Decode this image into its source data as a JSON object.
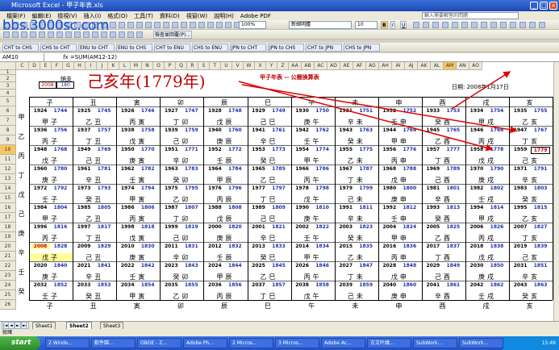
{
  "window": {
    "title": "Microsoft Excel - 甲子年表.xls",
    "help_placeholder": "輸入需要解答的問題"
  },
  "watermark": "bbs.3000sc.com",
  "menu": [
    "檔案(F)",
    "編輯(E)",
    "檢視(V)",
    "插入(I)",
    "格式(O)",
    "工具(T)",
    "資料(D)",
    "視窗(W)",
    "說明(H)",
    "Adobe PDF"
  ],
  "toolbar": {
    "zoom": "100%",
    "font": "新細明體",
    "size": "10",
    "review_label": "檢查並回覆(P)...",
    "bold": "B",
    "italic": "I",
    "underline": "U"
  },
  "convert_buttons": [
    "CHT to CHS",
    "CHS to CHT",
    "ENU to CHT",
    "ENU to CHS",
    "CHT to ENU",
    "CHS to ENU",
    "JPN to CHT",
    "JPN to CHS",
    "CHT to JPN",
    "CHS to JPN"
  ],
  "formula": {
    "namebox": "AM10",
    "fx": "fx",
    "content": "=SUM(AM12-12)"
  },
  "columns": [
    "C",
    "D",
    "E",
    "F",
    "G",
    "H",
    "I",
    "J",
    "K",
    "L",
    "M",
    "N",
    "O",
    "P",
    "Q",
    "R",
    "S",
    "T",
    "U",
    "V",
    "W",
    "X",
    "Y",
    "Z",
    "AA",
    "AB",
    "AC",
    "AD",
    "AE",
    "AF",
    "AG",
    "AH",
    "AI",
    "AJ",
    "AK",
    "AL",
    "AM",
    "AN",
    "AO"
  ],
  "rows": [
    "1",
    "2",
    "3",
    "4",
    "5",
    "6",
    "7",
    "8",
    "9",
    "10",
    "11",
    "12",
    "13",
    "14",
    "15",
    "16",
    "17",
    "18",
    "19",
    "20",
    "21",
    "22",
    "23",
    "24",
    "25",
    "26"
  ],
  "header": {
    "label_nazhi": "納支",
    "input_year": "2008",
    "input_gz": "180",
    "big_title": "己亥年(1779年)",
    "subtitle": "甲子年表 -- 公曆換算表",
    "date_label": "日期: 2008年1月17日"
  },
  "branches": [
    "子",
    "丑",
    "寅",
    "卯",
    "辰",
    "巳",
    "午",
    "未",
    "申",
    "酉",
    "戌",
    "亥"
  ],
  "left_stems": [
    "甲",
    "乙",
    "丙",
    "丁",
    "戊",
    "己",
    "庚",
    "辛",
    "壬",
    "癸"
  ],
  "table": [
    {
      "years": [
        [
          "1924",
          "1744"
        ],
        [
          "1925",
          "1745"
        ],
        [
          "1926",
          "1746"
        ],
        [
          "1927",
          "1747"
        ],
        [
          "1928",
          "1748"
        ],
        [
          "1929",
          "1749"
        ],
        [
          "1930",
          "1750"
        ],
        [
          "1931",
          "1751"
        ],
        [
          "1932",
          "1752"
        ],
        [
          "1933",
          "1753"
        ],
        [
          "1934",
          "1754"
        ],
        [
          "1935",
          "1755"
        ]
      ],
      "gz": [
        "甲子",
        "乙丑",
        "丙寅",
        "丁卯",
        "戊辰",
        "己巳",
        "庚午",
        "辛未",
        "壬申",
        "癸酉",
        "甲戌",
        "乙亥"
      ]
    },
    {
      "years": [
        [
          "1936",
          "1756"
        ],
        [
          "1937",
          "1757"
        ],
        [
          "1938",
          "1758"
        ],
        [
          "1939",
          "1759"
        ],
        [
          "1940",
          "1760"
        ],
        [
          "1941",
          "1761"
        ],
        [
          "1942",
          "1762"
        ],
        [
          "1943",
          "1763"
        ],
        [
          "1944",
          "1764"
        ],
        [
          "1945",
          "1765"
        ],
        [
          "1946",
          "1766"
        ],
        [
          "1947",
          "1767"
        ]
      ],
      "gz": [
        "丙子",
        "丁丑",
        "戊寅",
        "己卯",
        "庚辰",
        "辛巳",
        "壬午",
        "癸未",
        "甲申",
        "乙酉",
        "丙戌",
        "丁亥"
      ]
    },
    {
      "years": [
        [
          "1948",
          "1768"
        ],
        [
          "1949",
          "1769"
        ],
        [
          "1950",
          "1770"
        ],
        [
          "1951",
          "1771"
        ],
        [
          "1952",
          "1772"
        ],
        [
          "1953",
          "1773"
        ],
        [
          "1954",
          "1774"
        ],
        [
          "1955",
          "1775"
        ],
        [
          "1956",
          "1776"
        ],
        [
          "1957",
          "1777"
        ],
        [
          "1958",
          "1778"
        ],
        [
          "1959",
          "1779"
        ]
      ],
      "gz": [
        "戊子",
        "己丑",
        "庚寅",
        "辛卯",
        "壬辰",
        "癸巳",
        "甲午",
        "乙未",
        "丙申",
        "丁酉",
        "戊戌",
        "己亥"
      ]
    },
    {
      "years": [
        [
          "1960",
          "1780"
        ],
        [
          "1961",
          "1781"
        ],
        [
          "1962",
          "1782"
        ],
        [
          "1963",
          "1783"
        ],
        [
          "1964",
          "1784"
        ],
        [
          "1965",
          "1785"
        ],
        [
          "1966",
          "1786"
        ],
        [
          "1967",
          "1787"
        ],
        [
          "1968",
          "1788"
        ],
        [
          "1969",
          "1789"
        ],
        [
          "1970",
          "1790"
        ],
        [
          "1971",
          "1791"
        ]
      ],
      "gz": [
        "庚子",
        "辛丑",
        "壬寅",
        "癸卯",
        "甲辰",
        "乙巳",
        "丙午",
        "丁未",
        "戊申",
        "己酉",
        "庚戌",
        "辛亥"
      ]
    },
    {
      "years": [
        [
          "1972",
          "1792"
        ],
        [
          "1973",
          "1793"
        ],
        [
          "1974",
          "1794"
        ],
        [
          "1975",
          "1795"
        ],
        [
          "1976",
          "1796"
        ],
        [
          "1977",
          "1797"
        ],
        [
          "1978",
          "1798"
        ],
        [
          "1979",
          "1799"
        ],
        [
          "1980",
          "1800"
        ],
        [
          "1981",
          "1801"
        ],
        [
          "1982",
          "1802"
        ],
        [
          "1983",
          "1803"
        ]
      ],
      "gz": [
        "壬子",
        "癸丑",
        "甲寅",
        "乙卯",
        "丙辰",
        "丁巳",
        "戊午",
        "己未",
        "庚申",
        "辛酉",
        "壬戌",
        "癸亥"
      ]
    },
    {
      "years": [
        [
          "1984",
          "1804"
        ],
        [
          "1985",
          "1805"
        ],
        [
          "1986",
          "1806"
        ],
        [
          "1987",
          "1807"
        ],
        [
          "1988",
          "1808"
        ],
        [
          "1989",
          "1809"
        ],
        [
          "1990",
          "1810"
        ],
        [
          "1991",
          "1811"
        ],
        [
          "1992",
          "1812"
        ],
        [
          "1993",
          "1813"
        ],
        [
          "1994",
          "1814"
        ],
        [
          "1995",
          "1815"
        ]
      ],
      "gz": [
        "甲子",
        "乙丑",
        "丙寅",
        "丁卯",
        "戊辰",
        "己巳",
        "庚午",
        "辛未",
        "壬申",
        "癸酉",
        "甲戌",
        "乙亥"
      ]
    },
    {
      "years": [
        [
          "1996",
          "1816"
        ],
        [
          "1997",
          "1817"
        ],
        [
          "1998",
          "1818"
        ],
        [
          "1999",
          "1819"
        ],
        [
          "2000",
          "1820"
        ],
        [
          "2001",
          "1821"
        ],
        [
          "2002",
          "1822"
        ],
        [
          "2003",
          "1823"
        ],
        [
          "2004",
          "1824"
        ],
        [
          "2005",
          "1825"
        ],
        [
          "2006",
          "1826"
        ],
        [
          "2007",
          "1827"
        ]
      ],
      "gz": [
        "丙子",
        "丁丑",
        "戊寅",
        "己卯",
        "庚辰",
        "辛巳",
        "壬午",
        "癸未",
        "甲申",
        "乙酉",
        "丙戌",
        "丁亥"
      ]
    },
    {
      "years": [
        [
          "2008",
          "1828"
        ],
        [
          "2009",
          "1829"
        ],
        [
          "2010",
          "1830"
        ],
        [
          "2011",
          "1831"
        ],
        [
          "2012",
          "1832"
        ],
        [
          "2013",
          "1833"
        ],
        [
          "2014",
          "1834"
        ],
        [
          "2015",
          "1835"
        ],
        [
          "2016",
          "1836"
        ],
        [
          "2017",
          "1837"
        ],
        [
          "2018",
          "1838"
        ],
        [
          "2019",
          "1839"
        ]
      ],
      "gz": [
        "戊子",
        "己丑",
        "庚寅",
        "辛卯",
        "壬辰",
        "癸巳",
        "甲午",
        "乙未",
        "丙申",
        "丁酉",
        "戊戌",
        "己亥"
      ]
    },
    {
      "years": [
        [
          "2020",
          "1840"
        ],
        [
          "2021",
          "1841"
        ],
        [
          "2022",
          "1842"
        ],
        [
          "2023",
          "1843"
        ],
        [
          "2024",
          "1844"
        ],
        [
          "2025",
          "1845"
        ],
        [
          "2026",
          "1846"
        ],
        [
          "2027",
          "1847"
        ],
        [
          "2028",
          "1848"
        ],
        [
          "2029",
          "1849"
        ],
        [
          "2030",
          "1850"
        ],
        [
          "2031",
          "1851"
        ]
      ],
      "gz": [
        "庚子",
        "辛丑",
        "壬寅",
        "癸卯",
        "甲辰",
        "乙巳",
        "丙午",
        "丁未",
        "戊申",
        "己酉",
        "庚戌",
        "辛亥"
      ]
    },
    {
      "years": [
        [
          "2032",
          "1852"
        ],
        [
          "2033",
          "1853"
        ],
        [
          "2034",
          "1854"
        ],
        [
          "2035",
          "1855"
        ],
        [
          "2036",
          "1856"
        ],
        [
          "2037",
          "1857"
        ],
        [
          "2038",
          "1858"
        ],
        [
          "2039",
          "1859"
        ],
        [
          "2040",
          "1860"
        ],
        [
          "2041",
          "1861"
        ],
        [
          "2042",
          "1862"
        ],
        [
          "2043",
          "1863"
        ]
      ],
      "gz": [
        "壬子",
        "癸丑",
        "甲寅",
        "乙卯",
        "丙辰",
        "丁巳",
        "戊午",
        "己未",
        "庚申",
        "辛酉",
        "壬戌",
        "癸亥"
      ]
    }
  ],
  "sheets": [
    "Sheet1",
    "Sheet2",
    "Sheet3"
  ],
  "active_sheet": "Sheet2",
  "status": "就緒",
  "taskbar": {
    "start": "start",
    "tasks": [
      "2 Windo...",
      "軟件園...",
      "OBOE - Z...",
      "Adobe Ph...",
      "2 Micros...",
      "3 Micros...",
      "Adobe Ac...",
      "古文叶緣...",
      "SubWork...",
      "SubWork..."
    ],
    "clock": "15:49"
  },
  "colors": {
    "red": "#c00000",
    "blue": "#1c2fa8",
    "highlight": "#ffff99"
  }
}
